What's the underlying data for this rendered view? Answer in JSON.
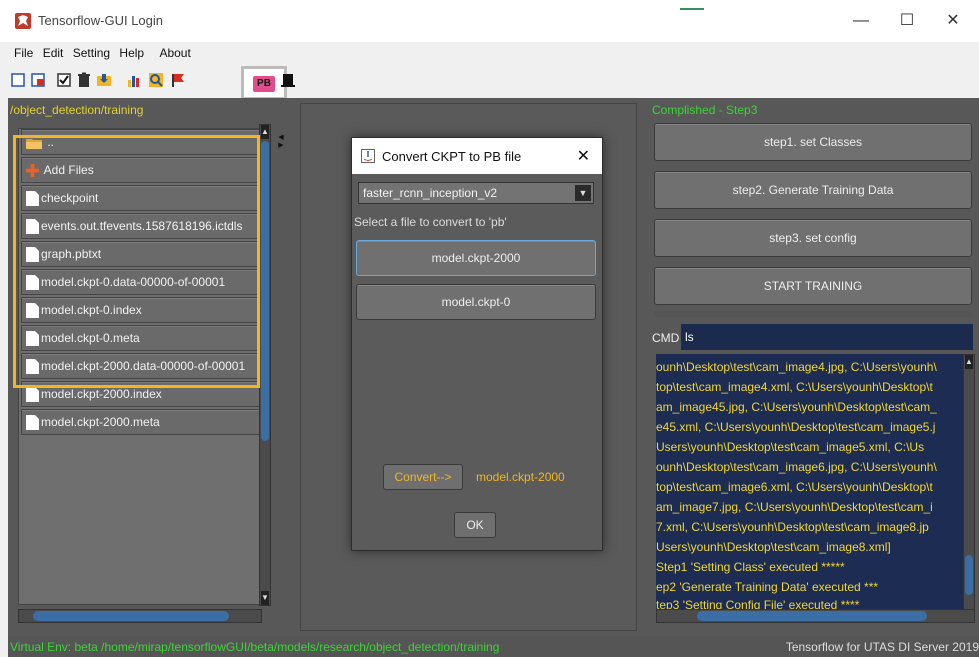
{
  "window": {
    "title": "Tensorflow-GUI Login",
    "controls": {
      "minimize": "—",
      "maximize": "☐",
      "close": "✕"
    }
  },
  "menu": [
    "File",
    "Edit",
    "Setting",
    "Help",
    "About"
  ],
  "toolbar": {
    "pb_label": "PB",
    "icons": [
      "new-file-icon",
      "red-file-icon",
      "checkbox-icon",
      "trash-icon",
      "import-icon",
      "chart-icon",
      "magnifier-icon",
      "flag-icon",
      "pb-icon",
      "export-icon"
    ]
  },
  "left_panel": {
    "path": "/object_detection/training",
    "parent_folder": "..",
    "add_files": "Add Files",
    "files": [
      "checkpoint",
      "events.out.tfevents.1587618196.ictdls",
      "graph.pbtxt",
      "model.ckpt-0.data-00000-of-00001",
      "model.ckpt-0.index",
      "model.ckpt-0.meta",
      "model.ckpt-2000.data-00000-of-00001",
      "model.ckpt-2000.index",
      "model.ckpt-2000.meta"
    ]
  },
  "dialog": {
    "title": "Convert CKPT to PB file",
    "close": "✕",
    "model_select": "faster_rcnn_inception_v2",
    "instruction": "Select a file to convert to 'pb'",
    "options": [
      "model.ckpt-2000",
      "model.ckpt-0"
    ],
    "convert_button": "Convert-->",
    "convert_target": "model.ckpt-2000",
    "ok_button": "OK"
  },
  "right_panel": {
    "status": "Complished - Step3",
    "steps": [
      "step1. set Classes",
      "step2. Generate Training Data",
      "step3. set config",
      "START TRAINING"
    ],
    "cmd_label": "CMD",
    "cmd_value": "ls",
    "console_lines": [
      "ounh\\Desktop\\test\\cam_image4.jpg, C:\\Users\\younh\\",
      "top\\test\\cam_image4.xml, C:\\Users\\younh\\Desktop\\t",
      "am_image45.jpg, C:\\Users\\younh\\Desktop\\test\\cam_",
      "e45.xml, C:\\Users\\younh\\Desktop\\test\\cam_image5.j",
      "Users\\younh\\Desktop\\test\\cam_image5.xml, C:\\Us",
      "ounh\\Desktop\\test\\cam_image6.jpg, C:\\Users\\younh\\",
      "top\\test\\cam_image6.xml, C:\\Users\\younh\\Desktop\\t",
      "am_image7.jpg, C:\\Users\\younh\\Desktop\\test\\cam_i",
      "7.xml, C:\\Users\\younh\\Desktop\\test\\cam_image8.jp",
      "Users\\younh\\Desktop\\test\\cam_image8.xml]",
      "Step1 'Setting Class' executed *****",
      "ep2 'Generate Training Data' executed ***",
      "tep3 'Setting Config File' executed ****"
    ]
  },
  "statusbar": {
    "venv": "Virtual Env: beta /home/mirap/tensorflowGUI/beta/models/research/object_detection/training",
    "server": "Tensorflow for UTAS DI Server 2019"
  },
  "colors": {
    "panel_bg": "#585858",
    "path_yellow": "#e2d22b",
    "highlight_orange": "#f1b625",
    "status_green": "#3bd535",
    "console_bg": "#1d2c52",
    "pb_pink": "#e24e8b"
  }
}
